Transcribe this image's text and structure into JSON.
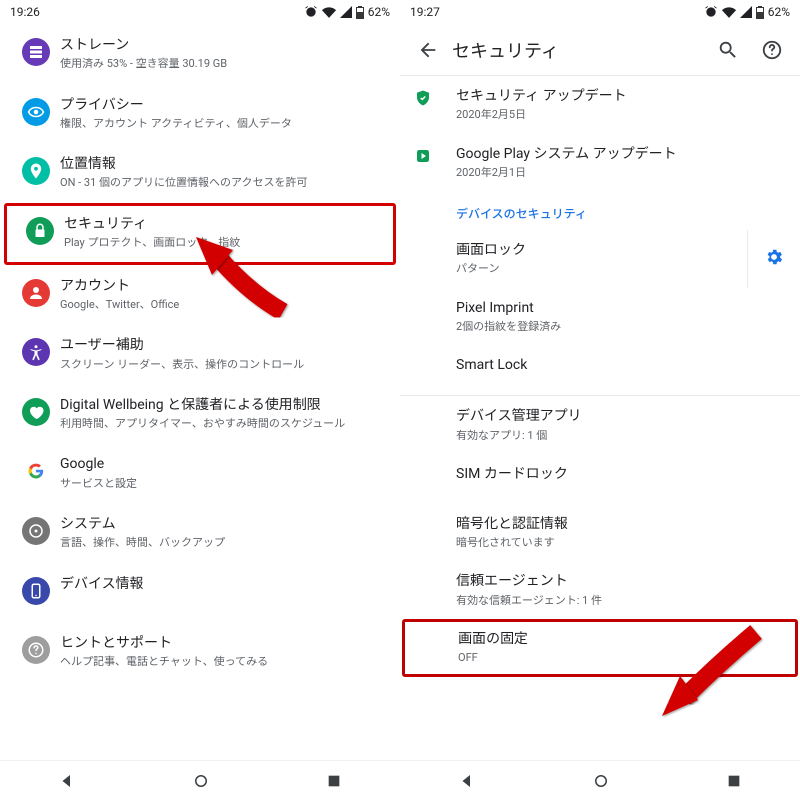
{
  "left": {
    "status": {
      "time": "19:26",
      "battery": "62%"
    },
    "items": [
      {
        "color": "#673ab7",
        "icon": "storage",
        "title": "ストレーン",
        "sub": "使用済み 53% - 空き容量 30.19 GB"
      },
      {
        "color": "#039be5",
        "icon": "privacy",
        "title": "プライバシー",
        "sub": "権限、アカウント アクティビティ、個人データ"
      },
      {
        "color": "#00bfa5",
        "icon": "location",
        "title": "位置情報",
        "sub": "ON - 31 個のアプリに位置情報へのアクセスを許可"
      },
      {
        "color": "#0f9d58",
        "icon": "security",
        "title": "セキュリティ",
        "sub": "Play プロテクト、画面ロック、指紋",
        "hl": true
      },
      {
        "color": "#e53935",
        "icon": "account",
        "title": "アカウント",
        "sub": "Google、Twitter、Office"
      },
      {
        "color": "#5e35b1",
        "icon": "a11y",
        "title": "ユーザー補助",
        "sub": "スクリーン リーダー、表示、操作のコントロール"
      },
      {
        "color": "#0f9d58",
        "icon": "wellbeing",
        "title": "Digital Wellbeing と保護者による使用制限",
        "sub": "利用時間、アプリタイマー、おやすみ時間のスケジュール"
      },
      {
        "color": "#ffffff",
        "icon": "google",
        "title": "Google",
        "sub": "サービスと設定"
      },
      {
        "color": "#757575",
        "icon": "system",
        "title": "システム",
        "sub": "言語、操作、時間、バックアップ"
      },
      {
        "color": "#3949ab",
        "icon": "device",
        "title": "デバイス情報",
        "sub": "​"
      },
      {
        "color": "#9e9e9e",
        "icon": "tip",
        "title": "ヒントとサポート",
        "sub": "ヘルプ記事、電話とチャット、使ってみる"
      }
    ]
  },
  "right": {
    "status": {
      "time": "19:27",
      "battery": "62%"
    },
    "header_title": "セキュリティ",
    "updates": [
      {
        "icon": "shield",
        "title": "セキュリティ アップデート",
        "sub": "2020年2月5日"
      },
      {
        "icon": "play",
        "title": "Google Play システム アップデート",
        "sub": "2020年2月1日"
      }
    ],
    "section_label": "デバイスのセキュリティ",
    "items": [
      {
        "title": "画面ロック",
        "sub": "パターン",
        "gear": true,
        "vdiv": true
      },
      {
        "title": "Pixel Imprint",
        "sub": "2個の指紋を登録済み"
      },
      {
        "title": "Smart Lock",
        "sub": ""
      },
      {
        "title": "デバイス管理アプリ",
        "sub": "有効なアプリ: 1 個",
        "divider_before": true
      },
      {
        "title": "SIM カードロック",
        "sub": ""
      },
      {
        "title": "暗号化と認証情報",
        "sub": "暗号化されています"
      },
      {
        "title": "信頼エージェント",
        "sub": "有効な信頼エージェント: 1 件"
      },
      {
        "title": "画面の固定",
        "sub": "OFF",
        "hl": true
      }
    ]
  }
}
